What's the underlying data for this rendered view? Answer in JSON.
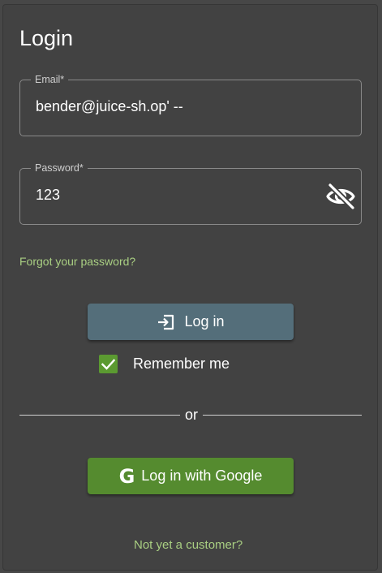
{
  "login": {
    "title": "Login",
    "email": {
      "label": "Email*",
      "value": "bender@juice-sh.op' --"
    },
    "password": {
      "label": "Password*",
      "value": "123",
      "toggle_icon": "eye-off-icon"
    },
    "forgot_password": "Forgot your password?",
    "login_button": {
      "label": "Log in",
      "icon": "login-icon"
    },
    "remember_me": {
      "label": "Remember me",
      "checked": true
    },
    "divider_text": "or",
    "google_button": {
      "label": "Log in with Google",
      "icon": "google-icon"
    },
    "signup_link": "Not yet a customer?"
  },
  "colors": {
    "background": "#474747",
    "card": "#424242",
    "primary_button": "#546e7a",
    "accent_green": "#558b2f",
    "link_green": "#a9cf82"
  }
}
